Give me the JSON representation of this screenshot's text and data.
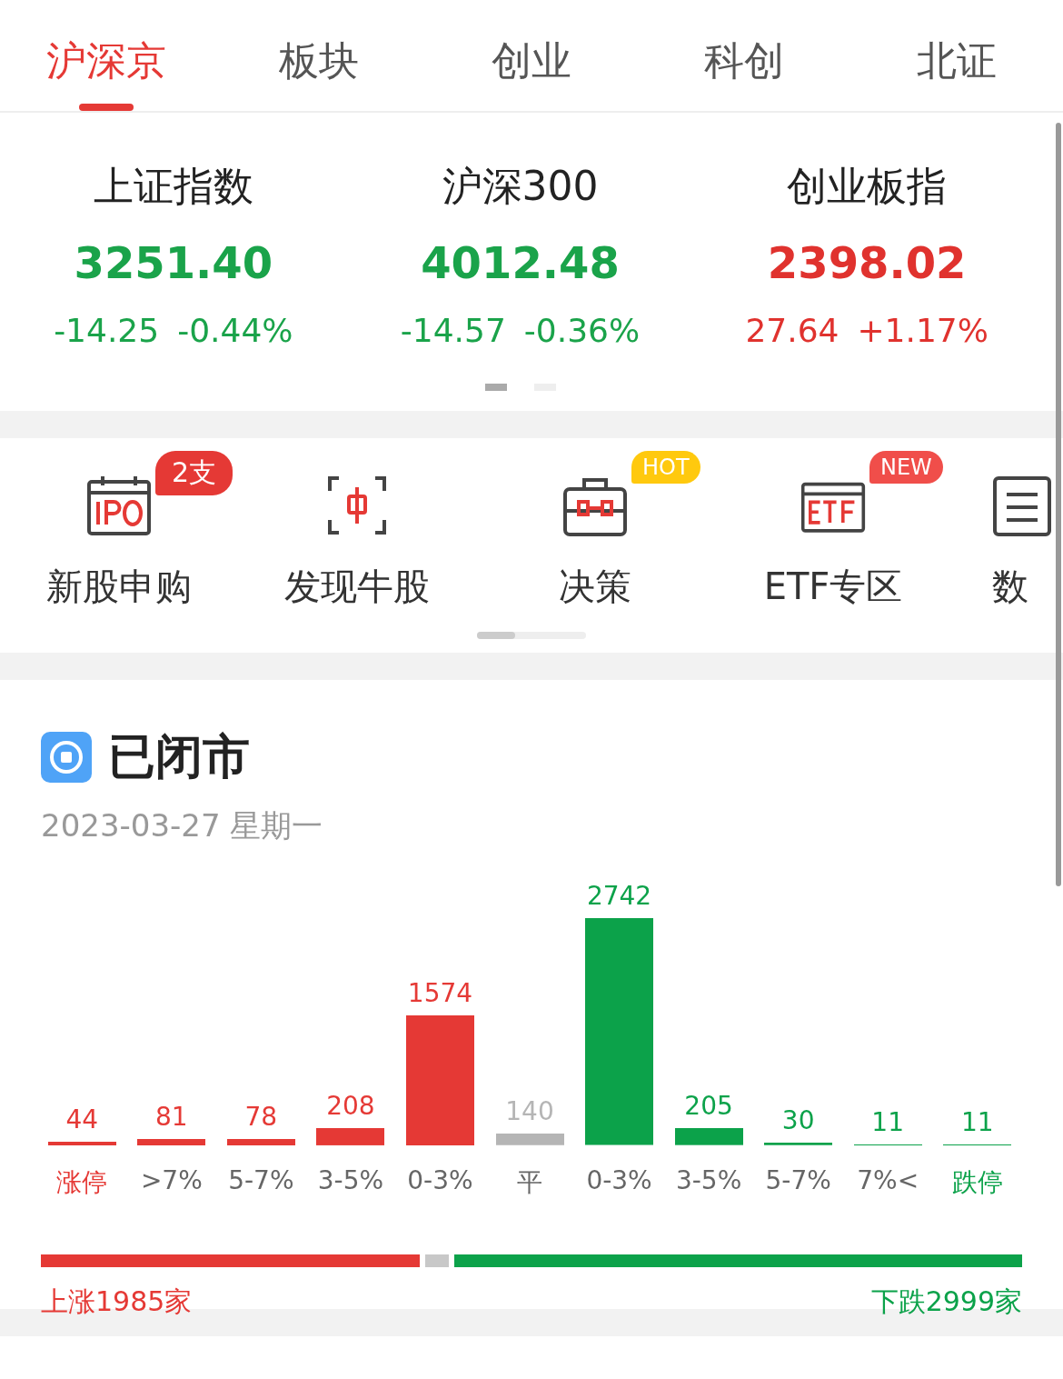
{
  "tabs": [
    {
      "label": "沪深京",
      "selected": true
    },
    {
      "label": "板块",
      "selected": false
    },
    {
      "label": "创业",
      "selected": false
    },
    {
      "label": "科创",
      "selected": false
    },
    {
      "label": "北证",
      "selected": false
    }
  ],
  "indices": [
    {
      "name": "上证指数",
      "value": "3251.40",
      "change": "-14.25",
      "percent": "-0.44%",
      "kind": "down"
    },
    {
      "name": "沪深300",
      "value": "4012.48",
      "change": "-14.57",
      "percent": "-0.36%",
      "kind": "down"
    },
    {
      "name": "创业板指",
      "value": "2398.02",
      "change": "27.64",
      "percent": "+1.17%",
      "kind": "up"
    }
  ],
  "pager": [
    {
      "selected": true
    },
    {
      "selected": false
    }
  ],
  "shortcuts": [
    {
      "label": "新股申购",
      "kind": "ipo",
      "badge": {
        "text": "2支",
        "kind": "count"
      }
    },
    {
      "label": "发现牛股",
      "kind": "scan"
    },
    {
      "label": "决策",
      "kind": "briefcase",
      "badge": {
        "text": "HOT",
        "kind": "hot"
      }
    },
    {
      "label": "ETF专区",
      "kind": "etf",
      "badge": {
        "text": "NEW",
        "kind": "new"
      }
    },
    {
      "label": "数",
      "kind": "list"
    }
  ],
  "market": {
    "status": "已闭市",
    "date": "2023-03-27 星期一",
    "chart_data": {
      "type": "bar",
      "data_labels": true,
      "categories": [
        "涨停",
        ">7%",
        "5-7%",
        "3-5%",
        "0-3%",
        "平",
        "0-3%",
        "3-5%",
        "5-7%",
        "7%<",
        "跌停"
      ],
      "series": [
        {
          "color": "#e53935",
          "values": [
            44,
            81,
            78,
            208,
            1574,
            null,
            null,
            null,
            null,
            null,
            null
          ]
        },
        {
          "color": "#b5b5b5",
          "values": [
            null,
            null,
            null,
            null,
            null,
            140,
            null,
            null,
            null,
            null,
            null
          ]
        },
        {
          "color": "#0ca24a",
          "values": [
            null,
            null,
            null,
            null,
            null,
            null,
            2742,
            205,
            30,
            11,
            11
          ]
        }
      ]
    },
    "up_label": "上涨1985家",
    "down_label": "下跌2999家"
  }
}
